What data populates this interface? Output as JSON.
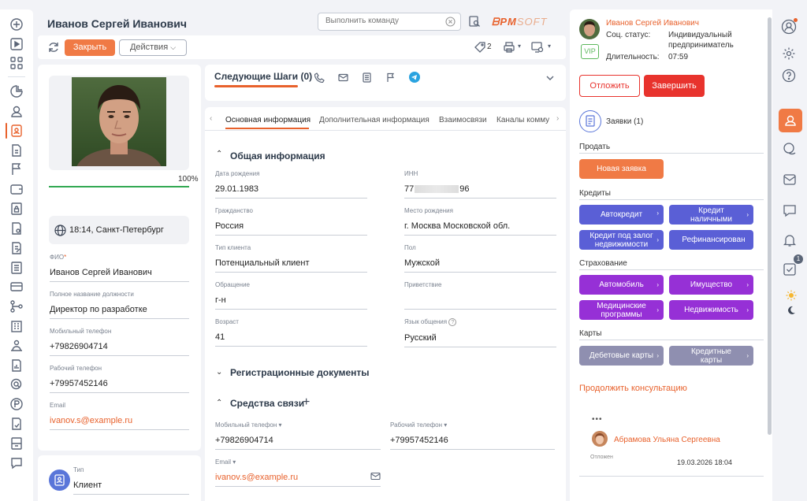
{
  "header": {
    "title": "Иванов Сергей Иванович",
    "command_placeholder": "Выполнить команду",
    "logo_a": "ᗷPM",
    "logo_b": "SOFT"
  },
  "toolbar": {
    "close": "Закрыть",
    "actions": "Действия",
    "tag_count": "2"
  },
  "profile": {
    "progress_text": "100%",
    "progress": 1.0,
    "location": "18:14, Санкт-Петербург",
    "fields": [
      {
        "label": "ФИО",
        "value": "Иванов Сергей Иванович",
        "required": true
      },
      {
        "label": "Полное название должности",
        "value": "Директор по разработке"
      },
      {
        "label": "Мобильный телефон",
        "value": "+79826904714"
      },
      {
        "label": "Рабочий телефон",
        "value": "+79957452146"
      },
      {
        "label": "Email",
        "value": "ivanov.s@example.ru"
      }
    ],
    "type_label": "Тип",
    "type_value": "Клиент"
  },
  "next_steps": {
    "title": "Следующие Шаги (0)"
  },
  "tabs": [
    "Основная информация",
    "Дополнительная информация",
    "Взаимосвязи",
    "Каналы комму"
  ],
  "general": {
    "title": "Общая информация",
    "left": [
      {
        "label": "Дата рождения",
        "value": "29.01.1983"
      },
      {
        "label": "Гражданство",
        "value": "Россия"
      },
      {
        "label": "Тип клиента",
        "value": "Потенциальный клиент"
      },
      {
        "label": "Обращение",
        "value": "г-н"
      },
      {
        "label": "Возраст",
        "value": "41"
      }
    ],
    "right": [
      {
        "label": "ИНН",
        "value_a": "77",
        "value_b": "96"
      },
      {
        "label": "Место рождения",
        "value": "г. Москва Московской обл."
      },
      {
        "label": "Пол",
        "value": "Мужской"
      },
      {
        "label": "Приветствие",
        "value": ""
      },
      {
        "label": "Язык общения",
        "value": "Русский"
      }
    ]
  },
  "reg_docs": {
    "title": "Регистрационные документы"
  },
  "comms": {
    "title": "Средства связи",
    "mobile_label": "Мобильный телефон",
    "mobile": "+79826904714",
    "work_label": "Рабочий телефон",
    "work": "+79957452146",
    "email_label": "Email",
    "email": "ivanov.s@example.ru"
  },
  "right_panel": {
    "name": "Иванов Сергей Иванович",
    "status_label": "Соц. статус:",
    "status_value_1": "Индивидуальный",
    "status_value_2": "предприниматель",
    "vip": "VIP",
    "duration_label": "Длительность:",
    "duration": "07:59",
    "postpone": "Отложить",
    "finish": "Завершить",
    "requests": "Заявки (1)",
    "sell": "Продать",
    "new_request": "Новая заявка",
    "credits": "Кредиты",
    "autocredit": "Автокредит",
    "cash_1": "Кредит",
    "cash_2": "наличными",
    "mortgage_1": "Кредит под залог",
    "mortgage_2": "недвижимости",
    "refinance": "Рефинансирован",
    "insurance": "Страхование",
    "car": "Автомобиль",
    "property": "Имущество",
    "medical_1": "Медицинские",
    "medical_2": "программы",
    "realestate": "Недвижимость",
    "cards": "Карты",
    "debit": "Дебетовые карты",
    "credit_1": "Кредитные",
    "credit_2": "карты",
    "continue": "Продолжить консультацию",
    "dots": "•••",
    "agent": "Абрамова Ульяна Сергеевна",
    "postponed": "Отложен",
    "date": "19.03.2026 18:04"
  },
  "right_rail": {
    "badge": "1"
  },
  "colors": {
    "accent": "#e8612c",
    "red": "#e8332d",
    "blue": "#5a5fd6",
    "purple": "#9630d6",
    "gray": "#8f8fb0"
  }
}
